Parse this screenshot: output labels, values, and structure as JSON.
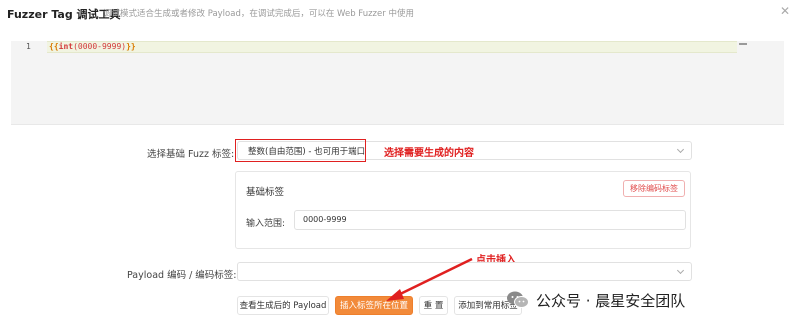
{
  "header": {
    "title": "Fuzzer Tag 调试工具",
    "subtitle": "调试模式适合生成或者修改 Payload，在调试完成后，可以在 Web Fuzzer 中使用",
    "close_glyph": "✕"
  },
  "editor": {
    "line_number": "1",
    "code": {
      "open": "{{",
      "func": "int",
      "args": "(0000-9999)",
      "close": "}}"
    }
  },
  "fuzz_tag": {
    "label": "选择基础 Fuzz 标签:",
    "value": "整数(自由范围) - 也可用于端口"
  },
  "annotations": {
    "select_content": "选择需要生成的内容",
    "click_insert": "点击插入"
  },
  "basic_panel": {
    "title": "基础标签",
    "remove_button": "移除编码标签",
    "range_label": "输入范围:",
    "range_value": "0000-9999"
  },
  "payload_encoding": {
    "label": "Payload 编码 / 编码标签:",
    "value": ""
  },
  "actions": {
    "view_payload": "查看生成后的 Payload",
    "insert_tag": "插入标签所在位置",
    "reset": "重 置",
    "add_common": "添加到常用标签"
  },
  "watermark": {
    "text": "公众号 · 晨星安全团队",
    "icon": "wechat-icon"
  },
  "colors": {
    "accent": "#f28a3a",
    "annotation_red": "#e02020",
    "current_line_bg": "#f1f4e1"
  }
}
